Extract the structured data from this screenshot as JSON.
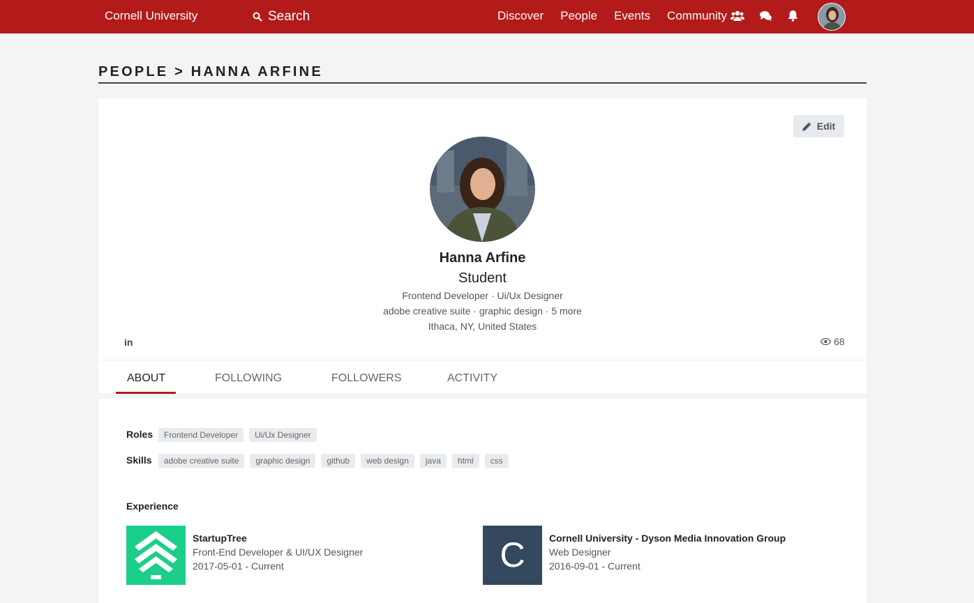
{
  "nav": {
    "brand": "Cornell University",
    "search_label": "Search",
    "links": [
      "Discover",
      "People",
      "Events",
      "Community"
    ],
    "icons": [
      "users-icon",
      "chat-icon",
      "bell-icon"
    ],
    "accent_color": "#b31b1b"
  },
  "breadcrumb": {
    "text": "PEOPLE > HANNA ARFINE"
  },
  "profile": {
    "edit_label": "Edit",
    "name": "Hanna Arfine",
    "status": "Student",
    "roles_line": "Frontend Developer · Ui/Ux Designer",
    "skills_line": "adobe creative suite · graphic design · 5 more",
    "location": "Ithaca, NY, United States",
    "linkedin_label": "in",
    "views": "68"
  },
  "tabs": [
    "ABOUT",
    "FOLLOWING",
    "FOLLOWERS",
    "ACTIVITY"
  ],
  "active_tab": "ABOUT",
  "about": {
    "roles_label": "Roles",
    "roles": [
      "Frontend Developer",
      "Ui/Ux Designer"
    ],
    "skills_label": "Skills",
    "skills": [
      "adobe creative suite",
      "graphic design",
      "github",
      "web design",
      "java",
      "html",
      "css"
    ],
    "experience_label": "Experience",
    "experience": [
      {
        "company": "StartupTree",
        "position": "Front-End Developer & UI/UX Designer",
        "dates": "2017-05-01 - Current",
        "logo_color": "#1bcf8a"
      },
      {
        "company": "Cornell University - Dyson Media Innovation Group",
        "position": "Web Designer",
        "dates": "2016-09-01 - Current",
        "logo_letter": "C",
        "logo_color": "#34495e"
      }
    ]
  }
}
